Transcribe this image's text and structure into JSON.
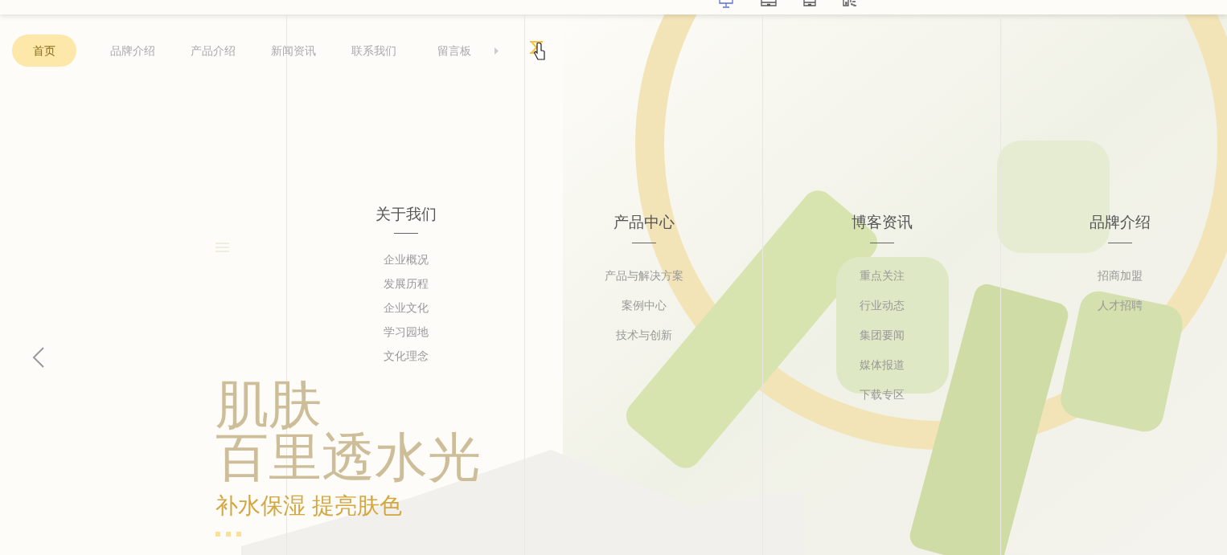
{
  "device_switcher": [
    {
      "kind": "desktop",
      "selected": true
    },
    {
      "kind": "tablet",
      "selected": false
    },
    {
      "kind": "phone",
      "selected": false
    },
    {
      "kind": "qrcode",
      "selected": false
    }
  ],
  "nav": {
    "items": [
      {
        "label": "首页",
        "selected": true
      },
      {
        "label": "品牌介绍",
        "selected": false
      },
      {
        "label": "产品介绍",
        "selected": false
      },
      {
        "label": "新闻资讯",
        "selected": false
      },
      {
        "label": "联系我们",
        "selected": false
      },
      {
        "label": "留言板",
        "selected": false
      }
    ]
  },
  "hero": {
    "title_lines": [
      "肌肤",
      "百里透水光"
    ],
    "subtitle": "补水保湿 提亮肤色"
  },
  "menu_columns": [
    {
      "title": "关于我们",
      "items": [
        "企业概况",
        "发展历程",
        "企业文化",
        "学习园地",
        "文化理念"
      ]
    },
    {
      "title": "产品中心",
      "items": [
        "产品与解决方案",
        "案例中心",
        "技术与创新"
      ]
    },
    {
      "title": "博客资讯",
      "items": [
        "重点关注",
        "行业动态",
        "集团要闻",
        "媒体报道",
        "下载专区"
      ]
    },
    {
      "title": "品牌介绍",
      "items": [
        "招商加盟",
        "人才招聘"
      ]
    }
  ]
}
